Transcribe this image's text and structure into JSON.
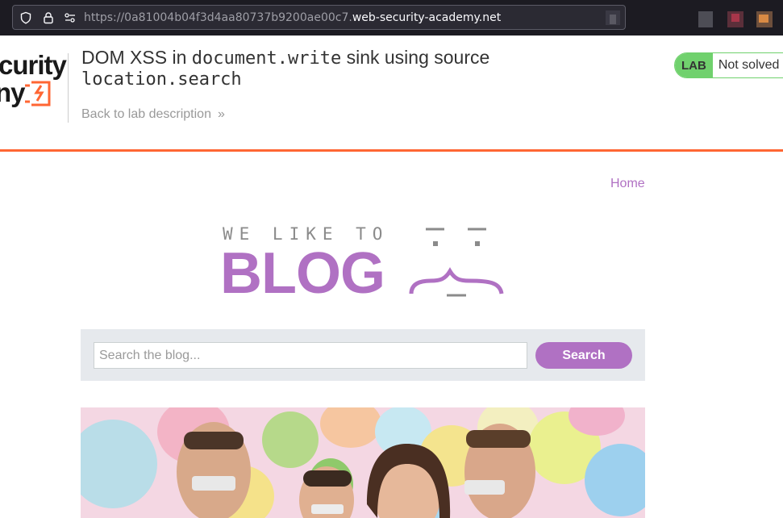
{
  "browser": {
    "url_prefix": "https://0a81004b04f3d4aa80737b9200ae00c7.",
    "url_domain": "web-security-academy.net"
  },
  "lab": {
    "logo_text_line1": "curity",
    "logo_text_line2": "ny",
    "title_prefix": "DOM XSS in ",
    "title_code1": "document.write",
    "title_mid": " sink using source",
    "title_code2": "location.search",
    "back_link": "Back to lab description",
    "badge": "LAB",
    "status": "Not solved",
    "accent_color": "#ff6633",
    "status_color": "#70d16d"
  },
  "nav": {
    "home": "Home"
  },
  "banner": {
    "tagline": "WE LIKE TO",
    "word": "BLOG",
    "color": "#b071c3"
  },
  "search": {
    "placeholder": "Search the blog...",
    "button_label": "Search"
  },
  "icons": {
    "shield": "shield-icon",
    "lock": "lock-icon",
    "permissions": "permissions-icon",
    "back_chevron": "double-chevron-right-icon"
  }
}
